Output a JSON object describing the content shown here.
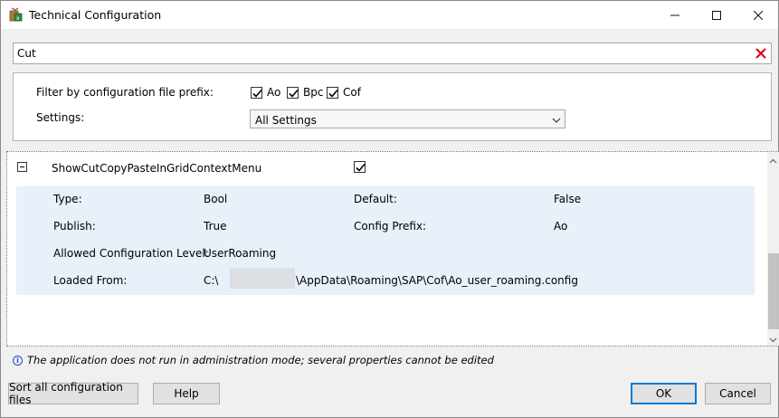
{
  "window": {
    "title": "Technical Configuration",
    "title_icon": "app-config-icon",
    "controls": {
      "minimize": "–",
      "maximize": "☐",
      "close": "✕"
    }
  },
  "search": {
    "value": "Cut",
    "clear_icon": "clear-x-icon",
    "clear_color": "#e0001b"
  },
  "filter": {
    "prefix_label": "Filter by configuration file prefix:",
    "prefixes": [
      {
        "label": "Ao",
        "checked": true
      },
      {
        "label": "Bpc",
        "checked": true
      },
      {
        "label": "Cof",
        "checked": true
      }
    ],
    "settings_label": "Settings:",
    "settings_selected": "All Settings"
  },
  "setting": {
    "name": "ShowCutCopyPasteInGridContextMenu",
    "enabled": true,
    "type_label": "Type:",
    "type_value": "Bool",
    "default_label": "Default:",
    "default_value": "False",
    "publish_label": "Publish:",
    "publish_value": "True",
    "config_prefix_label": "Config Prefix:",
    "config_prefix_value": "Ao",
    "allowed_level_label": "Allowed Configuration Level:",
    "allowed_level_value": "UserRoaming",
    "loaded_from_label": "Loaded From:",
    "loaded_from_prefix": "C:\\",
    "loaded_from_suffix": "\\AppData\\Roaming\\SAP\\Cof\\Ao_user_roaming.config"
  },
  "info": {
    "icon": "info-icon",
    "text": "The application does not run in administration mode; several properties cannot be edited"
  },
  "buttons": {
    "sort": "Sort all configuration files",
    "help": "Help",
    "ok": "OK",
    "cancel": "Cancel"
  },
  "colors": {
    "details_background": "#e8f0fa",
    "ok_border": "#0078d7",
    "info_icon": "#1a4fc7"
  }
}
